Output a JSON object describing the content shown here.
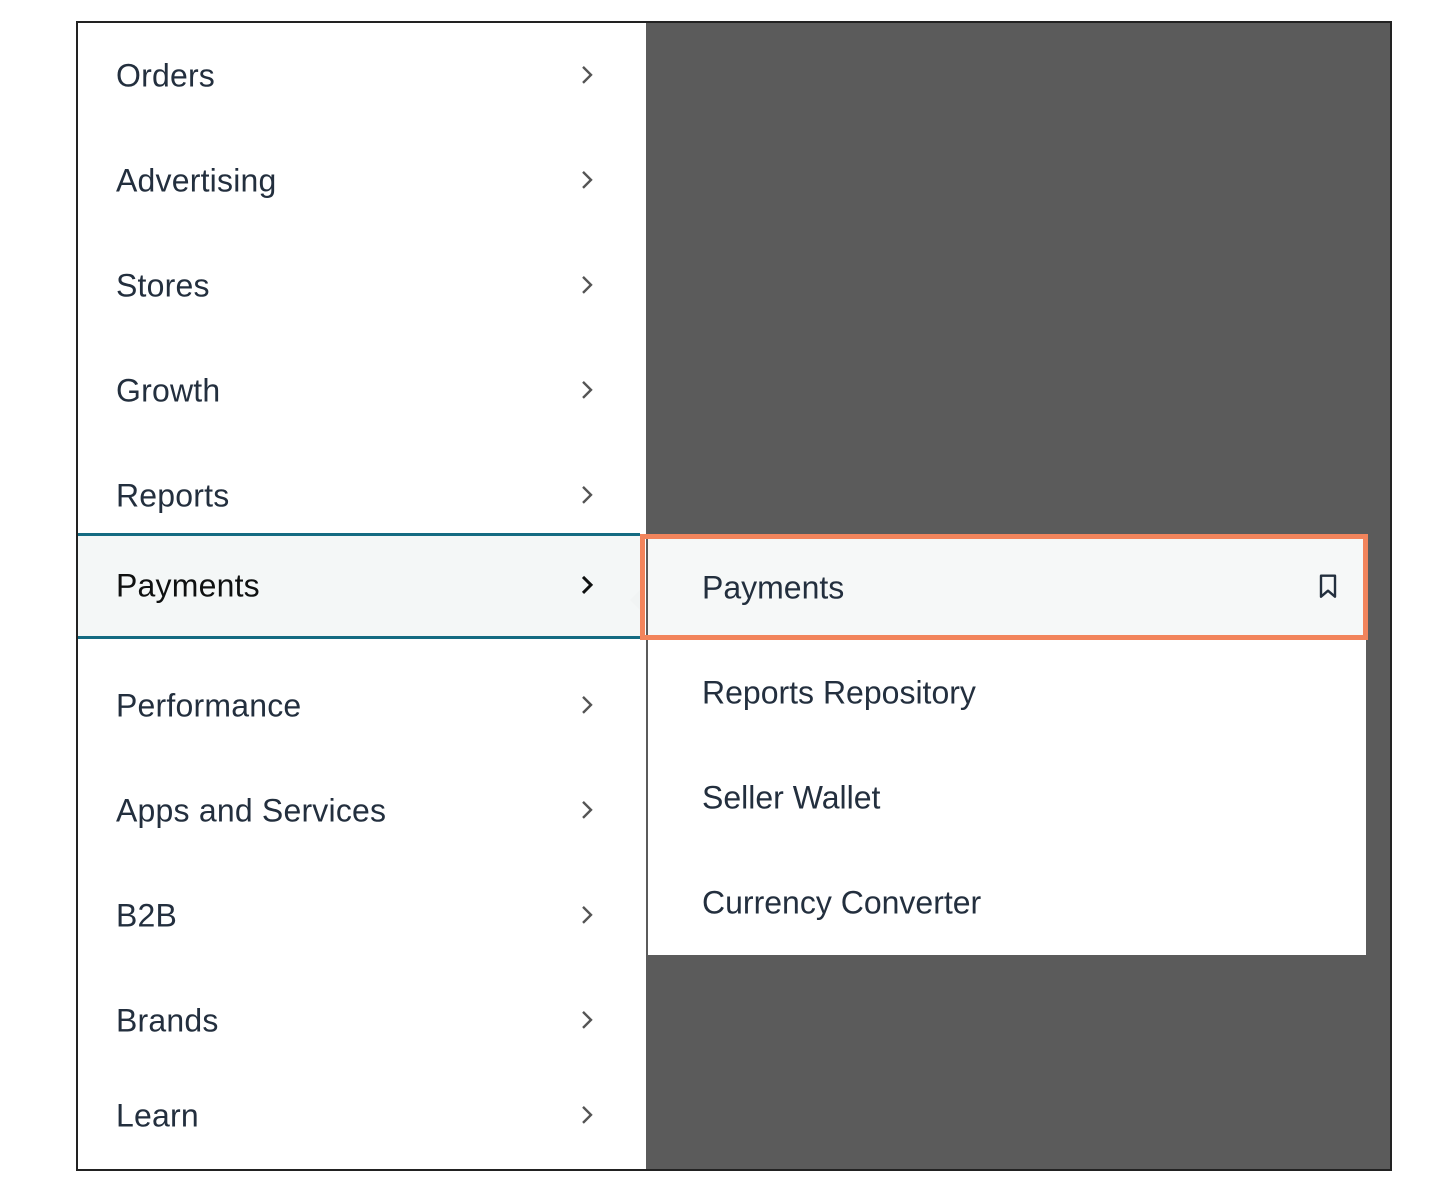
{
  "main_menu": {
    "items": [
      {
        "label": "Orders"
      },
      {
        "label": "Advertising"
      },
      {
        "label": "Stores"
      },
      {
        "label": "Growth"
      },
      {
        "label": "Reports"
      },
      {
        "label": "Payments",
        "active": true
      },
      {
        "label": "Performance"
      },
      {
        "label": "Apps and Services"
      },
      {
        "label": "B2B"
      },
      {
        "label": "Brands"
      },
      {
        "label": "Learn"
      }
    ]
  },
  "submenu": {
    "items": [
      {
        "label": "Payments",
        "highlighted": true,
        "icon": "bookmark-icon"
      },
      {
        "label": "Reports Repository"
      },
      {
        "label": "Seller Wallet"
      },
      {
        "label": "Currency Converter"
      }
    ]
  },
  "colors": {
    "active_border": "#146b82",
    "highlight_outline": "#f2845c",
    "overlay": "#5b5b5b",
    "text": "#232f3e"
  }
}
